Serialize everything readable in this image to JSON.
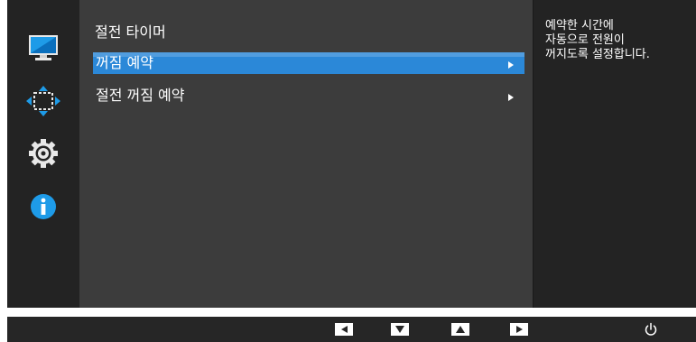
{
  "panel": {
    "title": "절전 타이머"
  },
  "menu": {
    "items": [
      {
        "label": "꺼짐 예약",
        "selected": true
      },
      {
        "label": "절전 꺼짐 예약",
        "selected": false
      }
    ]
  },
  "help": {
    "lines": [
      "예약한 시간에",
      "자동으로 전원이",
      "꺼지도록 설정합니다."
    ]
  },
  "sidebar": {
    "icons": [
      "picture-icon",
      "onscreen-display-icon",
      "system-gear-icon",
      "information-icon"
    ]
  },
  "bottom_bar": {
    "buttons": [
      "left-arrow-icon",
      "down-arrow-icon",
      "up-arrow-icon",
      "right-arrow-icon",
      "power-icon"
    ]
  },
  "colors": {
    "selection": "#2b88d8",
    "accent_blue": "#1e9be8",
    "panel_bg": "#3c3c3c",
    "frame_bg": "#262626"
  }
}
